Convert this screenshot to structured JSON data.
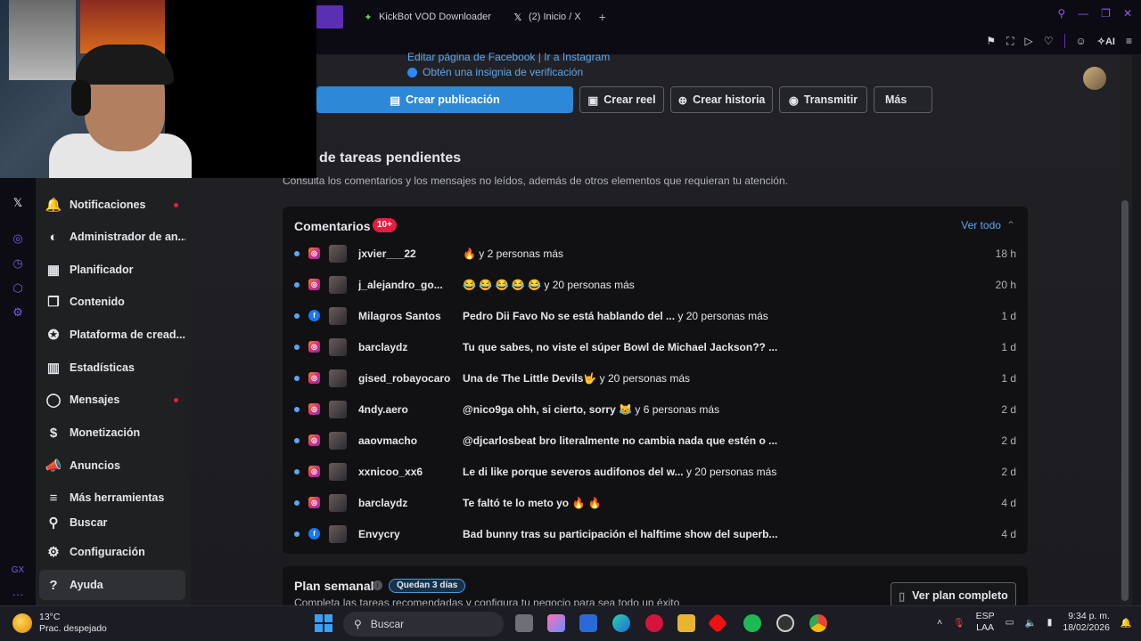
{
  "browser": {
    "tabs": [
      {
        "label": "KickBot VOD Downloader"
      },
      {
        "label": "(2) Inicio / X"
      }
    ],
    "ai_label": "AI"
  },
  "header": {
    "edit_links": "Editar página de Facebook | Ir a Instagram",
    "verification": "Obtén una insignia de verificación"
  },
  "actions": {
    "create_post": "Crear publicación",
    "create_reel": "Crear reel",
    "create_story": "Crear historia",
    "go_live": "Transmitir",
    "more": "Más"
  },
  "sidebar": {
    "items": [
      {
        "label": "Notificaciones",
        "icon": "bell-icon",
        "dot": true
      },
      {
        "label": "Administrador de an...",
        "icon": "ads-manager-icon",
        "dot": false
      },
      {
        "label": "Planificador",
        "icon": "calendar-icon",
        "dot": false
      },
      {
        "label": "Contenido",
        "icon": "content-icon",
        "dot": false
      },
      {
        "label": "Plataforma de cread...",
        "icon": "creator-icon",
        "dot": false
      },
      {
        "label": "Estadísticas",
        "icon": "stats-icon",
        "dot": false
      },
      {
        "label": "Mensajes",
        "icon": "chat-icon",
        "dot": true
      },
      {
        "label": "Monetización",
        "icon": "money-icon",
        "dot": false
      },
      {
        "label": "Anuncios",
        "icon": "megaphone-icon",
        "dot": false
      },
      {
        "label": "Más herramientas",
        "icon": "menu-icon",
        "dot": false
      },
      {
        "label": "Buscar",
        "icon": "search-icon",
        "dot": false
      },
      {
        "label": "Configuración",
        "icon": "gear-icon",
        "dot": false
      },
      {
        "label": "Ayuda",
        "icon": "help-icon",
        "dot": false
      }
    ]
  },
  "tasks": {
    "title": "de tareas pendientes",
    "subtitle": "Consulta los comentarios y los mensajes no leídos, además de otros elementos que requieran tu atención."
  },
  "comments": {
    "title": "Comentarios",
    "badge": "10+",
    "see_all": "Ver todo",
    "rows": [
      {
        "platform": "ig",
        "user": "jxvier___22",
        "text": "🔥",
        "more": "y 2 personas más",
        "time": "18 h"
      },
      {
        "platform": "ig",
        "user": "j_alejandro_go...",
        "text": "😂 😂 😂 😂 😂",
        "more": "y 20 personas más",
        "time": "20 h"
      },
      {
        "platform": "fb",
        "user": "Milagros Santos",
        "text": "Pedro Dii Favo No se está hablando del ...",
        "more": "y 20 personas más",
        "time": "1 d"
      },
      {
        "platform": "ig",
        "user": "barclaydz",
        "text": "Tu que sabes, no viste el súper Bowl de Michael Jackson?? ...",
        "more": "",
        "time": "1 d"
      },
      {
        "platform": "ig",
        "user": "gised_robayocaro",
        "text": "Una de The Little Devils🤟",
        "more": "y 20 personas más",
        "time": "1 d"
      },
      {
        "platform": "ig",
        "user": "4ndy.aero",
        "text": "@nico9ga ohh, si cierto, sorry 😹",
        "more": "y 6 personas más",
        "time": "2 d"
      },
      {
        "platform": "ig",
        "user": "aaovmacho",
        "text": "@djcarlosbeat bro literalmente no cambia nada que estén o ...",
        "more": "",
        "time": "2 d"
      },
      {
        "platform": "ig",
        "user": "xxnicoo_xx6",
        "text": "Le di like porque severos audifonos del w...",
        "more": "y 20 personas más",
        "time": "2 d"
      },
      {
        "platform": "ig",
        "user": "barclaydz",
        "text": "Te faltó te lo meto yo 🔥 🔥",
        "more": "",
        "time": "4 d"
      },
      {
        "platform": "fb",
        "user": "Envycry",
        "text": "Bad bunny tras su participación el halftime show del superb...",
        "more": "",
        "time": "4 d"
      }
    ]
  },
  "plan": {
    "title": "Plan semanal",
    "badge": "Quedan 3 días",
    "subtitle": "Completa las tareas recomendadas y configura tu negocio para sea todo un éxito",
    "button": "Ver plan completo"
  },
  "taskbar": {
    "weather_temp": "13°C",
    "weather_desc": "Prac. despejado",
    "search_placeholder": "Buscar",
    "lang1": "ESP",
    "lang2": "LAA",
    "time": "9:34 p. m.",
    "date": "18/02/2026"
  },
  "colors": {
    "accent": "#5aa7f0",
    "primary_button": "#2d88d8",
    "notification_dot": "#e41e3f",
    "opera_accent": "#7d5cf0"
  }
}
